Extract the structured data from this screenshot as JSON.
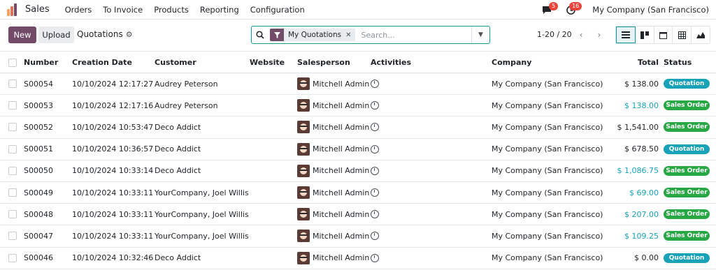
{
  "nav": {
    "brand": "Sales",
    "menu": [
      "Orders",
      "To Invoice",
      "Products",
      "Reporting",
      "Configuration"
    ],
    "messages_count": "5",
    "activities_count": "16",
    "company": "My Company (San Francisco)"
  },
  "controls": {
    "new_label": "New",
    "upload_label": "Upload",
    "breadcrumb": "Quotations",
    "search": {
      "facet_label": "My Quotations",
      "placeholder": "Search..."
    },
    "pager": "1-20 / 20"
  },
  "table": {
    "headers": {
      "number": "Number",
      "date": "Creation Date",
      "customer": "Customer",
      "website": "Website",
      "salesperson": "Salesperson",
      "activities": "Activities",
      "company": "Company",
      "total": "Total",
      "status": "Status"
    },
    "rows": [
      {
        "number": "S00054",
        "date": "10/10/2024 12:17:27",
        "customer": "Audrey Peterson",
        "salesperson": "Mitchell Admin",
        "company": "My Company (San Francisco)",
        "total": "$ 138.00",
        "status": "Quotation"
      },
      {
        "number": "S00053",
        "date": "10/10/2024 12:17:16",
        "customer": "Audrey Peterson",
        "salesperson": "Mitchell Admin",
        "company": "My Company (San Francisco)",
        "total": "$ 138.00",
        "status": "Sales Order"
      },
      {
        "number": "S00052",
        "date": "10/10/2024 10:53:47",
        "customer": "Deco Addict",
        "salesperson": "Mitchell Admin",
        "company": "My Company (San Francisco)",
        "total": "$ 1,541.00",
        "status": "Sales Order"
      },
      {
        "number": "S00051",
        "date": "10/10/2024 10:36:57",
        "customer": "Deco Addict",
        "salesperson": "Mitchell Admin",
        "company": "My Company (San Francisco)",
        "total": "$ 678.50",
        "status": "Quotation"
      },
      {
        "number": "S00050",
        "date": "10/10/2024 10:33:14",
        "customer": "Deco Addict",
        "salesperson": "Mitchell Admin",
        "company": "My Company (San Francisco)",
        "total": "$ 1,086.75",
        "status": "Sales Order"
      },
      {
        "number": "S00049",
        "date": "10/10/2024 10:33:11",
        "customer": "YourCompany, Joel Willis",
        "salesperson": "Mitchell Admin",
        "company": "My Company (San Francisco)",
        "total": "$ 69.00",
        "status": "Sales Order"
      },
      {
        "number": "S00048",
        "date": "10/10/2024 10:33:11",
        "customer": "YourCompany, Joel Willis",
        "salesperson": "Mitchell Admin",
        "company": "My Company (San Francisco)",
        "total": "$ 207.00",
        "status": "Sales Order"
      },
      {
        "number": "S00047",
        "date": "10/10/2024 10:33:11",
        "customer": "YourCompany, Joel Willis",
        "salesperson": "Mitchell Admin",
        "company": "My Company (San Francisco)",
        "total": "$ 109.25",
        "status": "Sales Order"
      },
      {
        "number": "S00046",
        "date": "10/10/2024 10:32:46",
        "customer": "Deco Addict",
        "salesperson": "Mitchell Admin",
        "company": "My Company (San Francisco)",
        "total": "$ 0.00",
        "status": "Quotation"
      }
    ]
  },
  "colors": {
    "brand_purple": "#714b67",
    "accent_teal": "#0f9b9b",
    "quotation_pill": "#17a2b8",
    "sales_order_pill": "#28a745",
    "total_blue": "#17a2b8",
    "badge_red": "#e8453c"
  },
  "icons": {
    "logo": "odoo-sales-logo",
    "messages": "chat-icon",
    "activities": "clock-icon",
    "search": "search-icon",
    "filter": "filter-icon",
    "gear": "gear-icon"
  }
}
